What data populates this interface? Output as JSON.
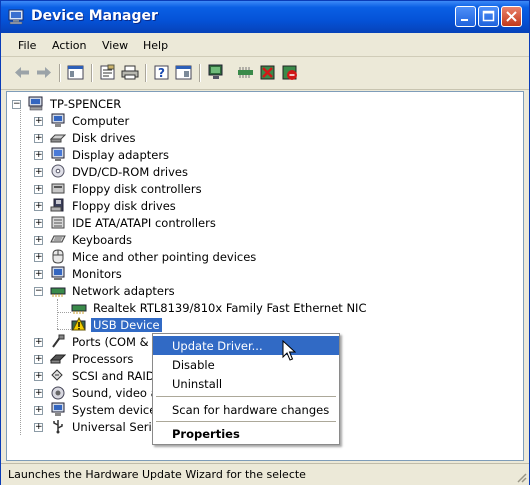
{
  "window": {
    "title": "Device Manager",
    "accent_color": "#0552d7"
  },
  "title_buttons": [
    "minimize-icon",
    "maximize-icon",
    "close-icon"
  ],
  "menubar": {
    "items": [
      "File",
      "Action",
      "View",
      "Help"
    ]
  },
  "toolbar": {
    "icons": [
      "back-arrow-icon",
      "forward-arrow-icon",
      "console-tree-icon",
      "properties-icon",
      "print-icon",
      "help-icon",
      "show-hide-icon",
      "scan-hardware-icon",
      "update-driver-icon",
      "uninstall-icon",
      "disable-icon"
    ]
  },
  "tree": {
    "root": "TP-SPENCER",
    "categories": [
      {
        "label": "Computer",
        "icon": "computer-icon"
      },
      {
        "label": "Disk drives",
        "icon": "disk-drive-icon"
      },
      {
        "label": "Display adapters",
        "icon": "display-adapter-icon"
      },
      {
        "label": "DVD/CD-ROM drives",
        "icon": "dvd-icon"
      },
      {
        "label": "Floppy disk controllers",
        "icon": "floppy-controller-icon"
      },
      {
        "label": "Floppy disk drives",
        "icon": "floppy-drive-icon"
      },
      {
        "label": "IDE ATA/ATAPI controllers",
        "icon": "ide-controller-icon"
      },
      {
        "label": "Keyboards",
        "icon": "keyboard-icon"
      },
      {
        "label": "Mice and other pointing devices",
        "icon": "mouse-icon"
      },
      {
        "label": "Monitors",
        "icon": "monitor-icon"
      },
      {
        "label": "Network adapters",
        "icon": "network-adapter-icon"
      }
    ],
    "network_children": [
      {
        "label": "Realtek RTL8139/810x Family Fast Ethernet NIC",
        "icon": "network-card-icon"
      },
      {
        "label": "USB Device",
        "icon": "warning-icon"
      }
    ],
    "more_categories": [
      {
        "label": "Ports (COM & L",
        "icon": "port-icon"
      },
      {
        "label": "Processors",
        "icon": "processor-icon"
      },
      {
        "label": "SCSI and RAID",
        "icon": "scsi-icon"
      },
      {
        "label": "Sound, video a",
        "icon": "sound-icon"
      },
      {
        "label": "System devices",
        "icon": "system-device-icon"
      },
      {
        "label": "Universal Seria",
        "icon": "usb-icon"
      }
    ]
  },
  "context_menu": {
    "update_driver": "Update Driver...",
    "disable": "Disable",
    "uninstall": "Uninstall",
    "scan": "Scan for hardware changes",
    "properties": "Properties"
  },
  "statusbar": {
    "text": "Launches the Hardware Update Wizard for the selecte"
  }
}
